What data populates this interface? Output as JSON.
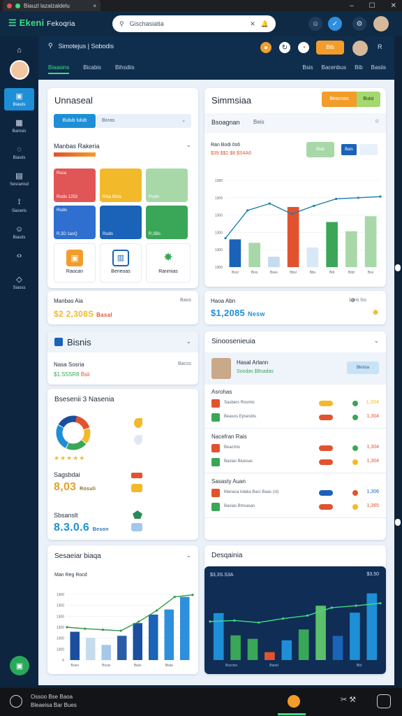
{
  "browser": {
    "tab_title": "Biauzl lazalzaldelu",
    "accent": "#3ddc84"
  },
  "window": {
    "minimize": "–",
    "maximize": "☐",
    "close": "✕"
  },
  "appbar": {
    "logo": "Ekeni",
    "logo_suffix": "Fekoqria",
    "search_text": "Gischasiatia",
    "search_close": "✕"
  },
  "sidebar": {
    "items": [
      {
        "label": "",
        "icon": "home-icon"
      },
      {
        "label": "Biasds",
        "icon": "dashboard-icon"
      },
      {
        "label": "Bamsis",
        "icon": "calendar-icon"
      },
      {
        "label": "Biasds",
        "icon": "chat-icon"
      },
      {
        "label": "Sesramsd",
        "icon": "grid-icon"
      },
      {
        "label": "Siaseris",
        "icon": "pin-icon"
      },
      {
        "label": "Biasds",
        "icon": "face-icon"
      },
      {
        "label": "",
        "icon": "arrows-icon"
      },
      {
        "label": "Siaoss",
        "icon": "tag-icon"
      }
    ]
  },
  "header": {
    "search_title": "Simotejus | Sobodis",
    "tabs": [
      "Biaasins",
      "Bicabis",
      "Bihsdiis"
    ],
    "right_tabs": [
      "Bsis",
      "Bacenbus",
      "Bib",
      "Basiis"
    ],
    "badge": "Bib"
  },
  "card_overview": {
    "title": "Unnaseal",
    "tabs": [
      "Bulub lulub",
      "Boras"
    ],
    "section": "Manbas Rakeria",
    "tiles": [
      {
        "label": "Rsoa",
        "value": "Rsdis 1253",
        "color": "#e05555"
      },
      {
        "label": "",
        "value": "Rlsa lBlda",
        "color": "#f2b92a"
      },
      {
        "label": "",
        "value": "Rsdis",
        "color": "#a8d8a8"
      },
      {
        "label": "Rsdis",
        "value": "R,3D 1asQ",
        "color": "#2f6fd0"
      },
      {
        "label": "",
        "value": "Rsdis",
        "color": "#1a63b8"
      },
      {
        "label": "",
        "value": "R,SBs",
        "color": "#3aa657"
      }
    ],
    "icons": [
      {
        "label": "Raocan"
      },
      {
        "label": "Beneoas"
      },
      {
        "label": "Ranmias"
      }
    ],
    "summary_label": "Manbas Aia",
    "summary_value": "$2 2,308S",
    "summary_tail": "Basal",
    "summary_right": "Baos"
  },
  "card_chart": {
    "title": "Simmsiaa",
    "btn1": "Beacnas",
    "btn2": "Buisi",
    "section": "Bsoagnan",
    "section_tail": "Beis",
    "legend_title": "Ran Bodi 0s6",
    "legend_vals": "$39 $$2 $8 $S4A6",
    "btn_a": "Blab",
    "btn_b": "Bais",
    "summary_label": "Haoa Abn",
    "summary_value": "$1,2085",
    "summary_tail": "Nesw",
    "summary_right": "1ans lss"
  },
  "chart_data": [
    {
      "type": "bar",
      "title": "",
      "categories": [
        "Bosl",
        "Biss",
        "Bses",
        "Bbsi",
        "Bbs",
        "Bdi",
        "Bdd",
        "Bxs"
      ],
      "values": [
        480,
        420,
        180,
        1040,
        340,
        780,
        620,
        880
      ],
      "line": [
        500,
        980,
        1100,
        920,
        1060,
        1180,
        1200,
        1220
      ],
      "ylim": [
        0,
        1500
      ],
      "yticks": [
        "1380",
        "1305",
        "1300",
        "1300",
        "1300",
        "1300"
      ],
      "colors": [
        "#1a63b8",
        "#a8d8a8",
        "#c5dcef",
        "#e2522f",
        "#d9e8f7",
        "#3aa657",
        "#a8d8a8",
        "#a8d8a8"
      ]
    },
    {
      "type": "bar",
      "title": "Man Reg Rocd",
      "categories": [
        "Bues",
        "",
        "Bicas",
        "",
        "Biais",
        "",
        "Biala",
        ""
      ],
      "values": [
        560,
        440,
        300,
        480,
        730,
        900,
        1000,
        1250
      ],
      "line": [
        650,
        620,
        600,
        580,
        760,
        980,
        1250,
        1290
      ],
      "ylim": [
        0,
        1300
      ],
      "yticks": [
        "1300",
        "1300",
        "1300",
        "1300",
        "1300",
        "1300",
        "0"
      ],
      "colors": [
        "#1a4fa0",
        "#c5dcef",
        "#a4c7ea",
        "#2a5ca8",
        "#1a4fa0",
        "#1a63b8",
        "#2d8fdd",
        "#2d8fdd"
      ]
    },
    {
      "type": "bar",
      "title": "$3,3S.S3A",
      "categories": [
        "Bscciss",
        "Baisd",
        "",
        "Bid"
      ],
      "values": [
        950,
        500,
        430,
        160,
        400,
        620,
        1100,
        490,
        960,
        1350
      ],
      "line": [
        780,
        800,
        760,
        840,
        900,
        1060,
        1100,
        1150
      ],
      "ylim": [
        0,
        1500
      ],
      "colors": [
        "#1e8fd6",
        "#3aa657",
        "#3aa657",
        "#e2522f",
        "#1e8fd6",
        "#3aa657",
        "#5bc06a",
        "#1a63b8",
        "#1e8fd6",
        "#1e8fd6"
      ]
    }
  ],
  "card_bisnis": {
    "title": "Bisnis",
    "label": "Nasa Sosria",
    "value": "$1.S5SR8",
    "value_tail": "Bsii",
    "right": "Bacss"
  },
  "card_donut": {
    "title": "Bsesenii 3 Nasenia",
    "stars": "★★★★★",
    "label1": "Sagsbdai",
    "value1": "8,03",
    "tail1": "Rosuli",
    "label2": "Sbsanslt",
    "value2": "8.3.0.6",
    "tail2": "Beson",
    "donut": [
      {
        "value": 20,
        "color": "#e2522f"
      },
      {
        "value": 15,
        "color": "#f2b92a"
      },
      {
        "value": 20,
        "color": "#3aa657"
      },
      {
        "value": 25,
        "color": "#1e8fd6"
      },
      {
        "value": 20,
        "color": "#1a4fa0"
      }
    ]
  },
  "card_sino": {
    "title": "Sinoosenieuia",
    "person": "Hasal Arlann",
    "person_sub": "Soodas $Bsadas",
    "btn": "Bkstsa",
    "groups": [
      {
        "title": "Asrohas",
        "rows": [
          {
            "text": "Sasbers Rosmis",
            "pill": "#f2b92a",
            "dot": "#3aa657",
            "val": "1,3S4"
          },
          {
            "text": "Beasos Epsesbis",
            "pill": "#e2522f",
            "dot": "#3aa657",
            "val": "1,304"
          }
        ]
      },
      {
        "title": "Nacefran Rais",
        "rows": [
          {
            "text": "Beacmis",
            "pill": "#e2522f",
            "dot": "#3aa657",
            "val": "1,304"
          },
          {
            "text": "Basias Biuesas",
            "pill": "#e2522f",
            "dot": "#f2b92a",
            "val": "1,304"
          }
        ]
      },
      {
        "title": "Sasasty Auan",
        "rows": [
          {
            "text": "Manasa lolaka Bacr Baas (sl)",
            "pill": "#1a63b8",
            "dot": "#e2522f",
            "val": "1,306"
          },
          {
            "text": "Basias Bmsasas",
            "pill": "#e2522f",
            "dot": "#f2b92a",
            "val": "1,365"
          }
        ]
      }
    ]
  },
  "card_bottom_left": {
    "title": "Sesaeiar biaqa"
  },
  "card_bottom_right": {
    "title": "Desqainia",
    "top_right": "$3,50"
  },
  "bottombar": {
    "line1": "Ossoo Bse Baoa",
    "line2": "Bleaeisa Bar Bues"
  }
}
